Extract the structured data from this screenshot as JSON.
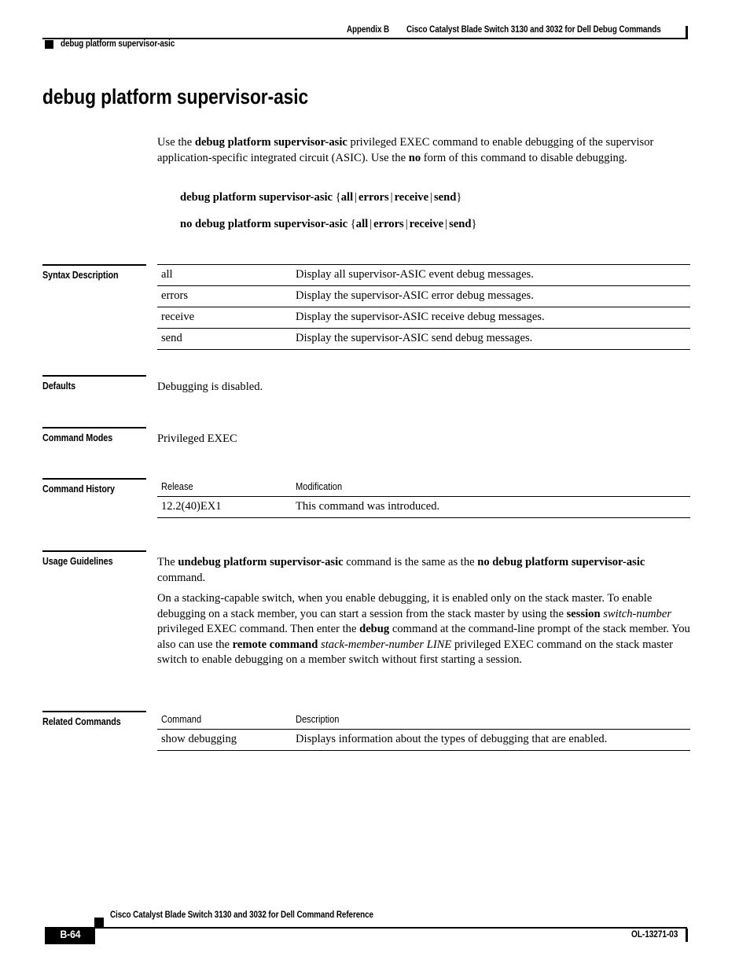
{
  "header": {
    "appendix": "Appendix B",
    "doc_title": "Cisco Catalyst Blade Switch 3130 and 3032 for Dell Debug Commands",
    "running_head": "debug platform supervisor-asic"
  },
  "page_title": "debug platform supervisor-asic",
  "intro": {
    "p1_part1": "Use the ",
    "p1_cmd": "debug platform supervisor-asic",
    "p1_part2": " privileged EXEC command to enable debugging of the supervisor application-specific integrated circuit (ASIC). Use the ",
    "p1_no": "no",
    "p1_part3": " form of this command to disable debugging."
  },
  "syntax": {
    "line1_cmd": "debug platform supervisor-asic",
    "line2_cmd": "no debug platform supervisor-asic",
    "open_brace": "{",
    "close_brace": "}",
    "separator": "|",
    "options": [
      "all",
      "errors",
      "receive",
      "send"
    ]
  },
  "sections": {
    "syntax_description": {
      "label": "Syntax Description",
      "rows": [
        {
          "term": "all",
          "desc": "Display all supervisor-ASIC event debug messages."
        },
        {
          "term": "errors",
          "desc": "Display the supervisor-ASIC error debug messages."
        },
        {
          "term": "receive",
          "desc": "Display the supervisor-ASIC receive debug messages."
        },
        {
          "term": "send",
          "desc": "Display the supervisor-ASIC send debug messages."
        }
      ]
    },
    "defaults": {
      "label": "Defaults",
      "text": "Debugging is disabled."
    },
    "command_modes": {
      "label": "Command Modes",
      "text": "Privileged EXEC"
    },
    "command_history": {
      "label": "Command History",
      "headers": [
        "Release",
        "Modification"
      ],
      "rows": [
        {
          "release": "12.2(40)EX1",
          "modification": "This command was introduced."
        }
      ]
    },
    "usage_guidelines": {
      "label": "Usage Guidelines",
      "p1_part1": "The ",
      "p1_cmd1": "undebug platform supervisor-asic",
      "p1_part2": " command is the same as the ",
      "p1_cmd2": "no debug platform supervisor-asic",
      "p1_part3": " command.",
      "p2_part1": "On a stacking-capable switch, when you enable debugging, it is enabled only on the stack master. To enable debugging on a stack member, you can start a session from the stack master by using the ",
      "p2_bold1": "session",
      "p2_ital1": "switch-number",
      "p2_part2": " privileged EXEC command. Then enter the ",
      "p2_bold2": "debug",
      "p2_part3": " command at the command-line prompt of the stack member. You also can use the ",
      "p2_bold3": "remote command",
      "p2_ital2": "stack-member-number LINE",
      "p2_part4": " privileged EXEC command on the stack master switch to enable debugging on a member switch without first starting a session."
    },
    "related_commands": {
      "label": "Related Commands",
      "headers": [
        "Command",
        "Description"
      ],
      "rows": [
        {
          "command": "show debugging",
          "description": "Displays information about the types of debugging that are enabled."
        }
      ]
    }
  },
  "footer": {
    "doc_title": "Cisco Catalyst Blade Switch 3130 and 3032 for Dell Command Reference",
    "page_number": "B-64",
    "doc_number": "OL-13271-03"
  }
}
